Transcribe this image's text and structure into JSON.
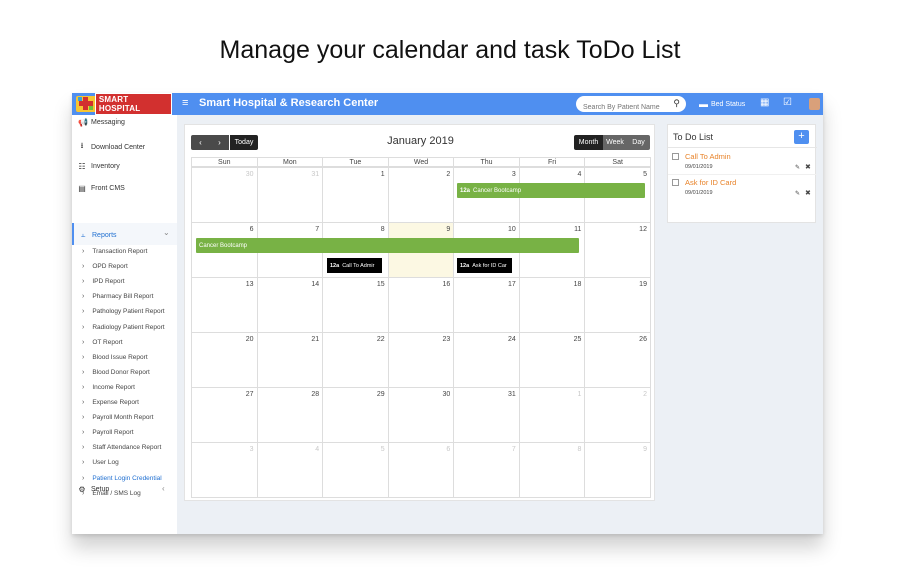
{
  "headline": "Manage your calendar and task ToDo List",
  "topbar": {
    "logo_text": "SMART HOSPITAL",
    "menu_icon": "≡",
    "app_title": "Smart Hospital & Research Center",
    "search_placeholder": "Search By Patient Name",
    "bed_status_label": "Bed Status",
    "color": "#4f8ff0"
  },
  "sidebar": {
    "items": [
      {
        "label": "Messaging",
        "icon": "bullhorn-icon",
        "glyph": "📢"
      },
      {
        "label": "Download Center",
        "icon": "download-icon",
        "glyph": "⭳"
      },
      {
        "label": "Inventory",
        "icon": "inventory-icon",
        "glyph": "☷"
      },
      {
        "label": "Front CMS",
        "icon": "cms-icon",
        "glyph": "▤"
      },
      {
        "label": "Reports",
        "icon": "chart-icon",
        "glyph": "⫠"
      },
      {
        "label": "Setup",
        "icon": "gears-icon",
        "glyph": "⚙"
      }
    ],
    "reports_caret": "⌄",
    "setup_caret": "‹",
    "report_links": [
      "Transaction Report",
      "OPD Report",
      "IPD Report",
      "Pharmacy Bill Report",
      "Pathology Patient Report",
      "Radiology Patient Report",
      "OT Report",
      "Blood Issue Report",
      "Blood Donor Report",
      "Income Report",
      "Expense Report",
      "Payroll Month Report",
      "Payroll Report",
      "Staff Attendance Report",
      "User Log",
      "Patient Login Credential",
      "Email / SMS Log"
    ],
    "active_report": "Patient Login Credential"
  },
  "calendar": {
    "prev_label": "‹",
    "next_label": "›",
    "today_label": "Today",
    "month_title": "January 2019",
    "views": [
      "Month",
      "Week",
      "Day"
    ],
    "active_view": "Month",
    "weekdays": [
      "Sun",
      "Mon",
      "Tue",
      "Wed",
      "Thu",
      "Fri",
      "Sat"
    ],
    "weeks": [
      [
        "30",
        "31",
        "1",
        "2",
        "3",
        "4",
        "5"
      ],
      [
        "6",
        "7",
        "8",
        "9",
        "10",
        "11",
        "12"
      ],
      [
        "13",
        "14",
        "15",
        "16",
        "17",
        "18",
        "19"
      ],
      [
        "20",
        "21",
        "22",
        "23",
        "24",
        "25",
        "26"
      ],
      [
        "27",
        "28",
        "29",
        "30",
        "31",
        "1",
        "2"
      ],
      [
        "3",
        "4",
        "5",
        "6",
        "7",
        "8",
        "9"
      ]
    ],
    "today_date": "9",
    "events": {
      "bootcamp_week1": {
        "time": "12a",
        "title": "Cancer Bootcamp"
      },
      "bootcamp_week2": {
        "title": "Cancer Bootcamp"
      },
      "call_admin": {
        "time": "12a",
        "title": "Call To Admir"
      },
      "ask_id": {
        "time": "12a",
        "title": "Ask for ID Car"
      }
    },
    "event_colors": {
      "bootcamp": "#78b245",
      "task": "#000000"
    }
  },
  "todo": {
    "title": "To Do List",
    "add_label": "+",
    "items": [
      {
        "label": "Call To Admin",
        "date": "09/01/2019",
        "edit": "✎",
        "delete": "✖"
      },
      {
        "label": "Ask for ID Card",
        "date": "09/01/2019",
        "edit": "✎",
        "delete": "✖"
      }
    ],
    "label_color": "#e8832a"
  }
}
